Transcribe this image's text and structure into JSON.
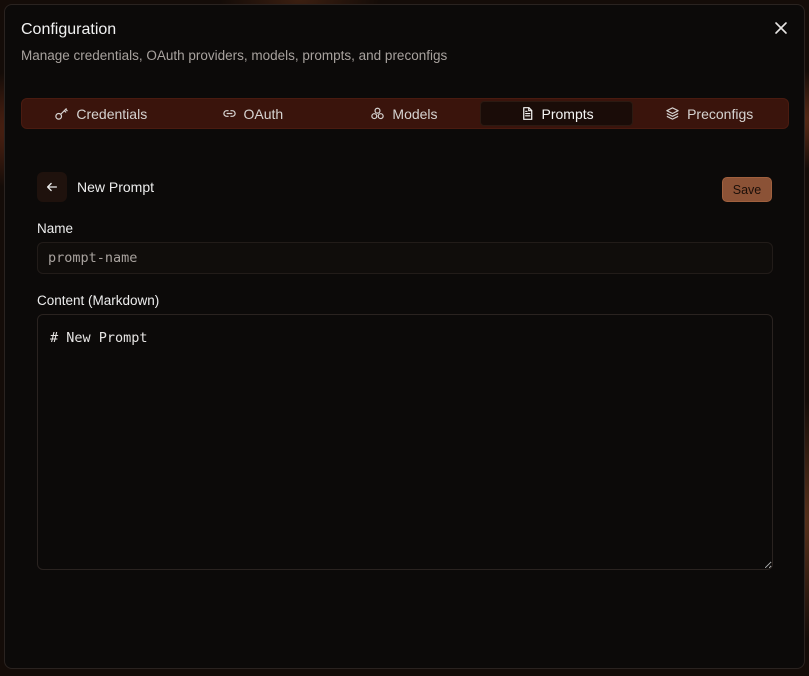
{
  "dialog": {
    "title": "Configuration",
    "subtitle": "Manage credentials, OAuth providers, models, prompts, and preconfigs"
  },
  "tabs": [
    {
      "label": "Credentials",
      "icon": "key-icon",
      "active": false
    },
    {
      "label": "OAuth",
      "icon": "link-icon",
      "active": false
    },
    {
      "label": "Models",
      "icon": "boxes-icon",
      "active": false
    },
    {
      "label": "Prompts",
      "icon": "file-text-icon",
      "active": true
    },
    {
      "label": "Preconfigs",
      "icon": "layers-icon",
      "active": false
    }
  ],
  "editor": {
    "page_title": "New Prompt",
    "save_label": "Save",
    "name_label": "Name",
    "name_placeholder": "prompt-name",
    "name_value": "",
    "content_label": "Content (Markdown)",
    "content_value": "# New Prompt"
  },
  "colors": {
    "accent": "#8b5236",
    "tab_bar": "#3a140c",
    "dialog_bg": "#0c0a09"
  }
}
